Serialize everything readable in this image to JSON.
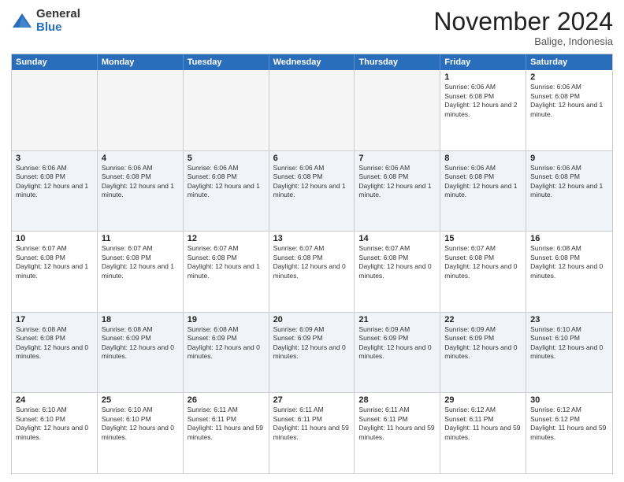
{
  "logo": {
    "general": "General",
    "blue": "Blue"
  },
  "header": {
    "month": "November 2024",
    "location": "Balige, Indonesia"
  },
  "weekdays": [
    "Sunday",
    "Monday",
    "Tuesday",
    "Wednesday",
    "Thursday",
    "Friday",
    "Saturday"
  ],
  "rows": [
    [
      {
        "day": "",
        "empty": true
      },
      {
        "day": "",
        "empty": true
      },
      {
        "day": "",
        "empty": true
      },
      {
        "day": "",
        "empty": true
      },
      {
        "day": "",
        "empty": true
      },
      {
        "day": "1",
        "sunrise": "Sunrise: 6:06 AM",
        "sunset": "Sunset: 6:08 PM",
        "daylight": "Daylight: 12 hours and 2 minutes."
      },
      {
        "day": "2",
        "sunrise": "Sunrise: 6:06 AM",
        "sunset": "Sunset: 6:08 PM",
        "daylight": "Daylight: 12 hours and 1 minute."
      }
    ],
    [
      {
        "day": "3",
        "sunrise": "Sunrise: 6:06 AM",
        "sunset": "Sunset: 6:08 PM",
        "daylight": "Daylight: 12 hours and 1 minute."
      },
      {
        "day": "4",
        "sunrise": "Sunrise: 6:06 AM",
        "sunset": "Sunset: 6:08 PM",
        "daylight": "Daylight: 12 hours and 1 minute."
      },
      {
        "day": "5",
        "sunrise": "Sunrise: 6:06 AM",
        "sunset": "Sunset: 6:08 PM",
        "daylight": "Daylight: 12 hours and 1 minute."
      },
      {
        "day": "6",
        "sunrise": "Sunrise: 6:06 AM",
        "sunset": "Sunset: 6:08 PM",
        "daylight": "Daylight: 12 hours and 1 minute."
      },
      {
        "day": "7",
        "sunrise": "Sunrise: 6:06 AM",
        "sunset": "Sunset: 6:08 PM",
        "daylight": "Daylight: 12 hours and 1 minute."
      },
      {
        "day": "8",
        "sunrise": "Sunrise: 6:06 AM",
        "sunset": "Sunset: 6:08 PM",
        "daylight": "Daylight: 12 hours and 1 minute."
      },
      {
        "day": "9",
        "sunrise": "Sunrise: 6:06 AM",
        "sunset": "Sunset: 6:08 PM",
        "daylight": "Daylight: 12 hours and 1 minute."
      }
    ],
    [
      {
        "day": "10",
        "sunrise": "Sunrise: 6:07 AM",
        "sunset": "Sunset: 6:08 PM",
        "daylight": "Daylight: 12 hours and 1 minute."
      },
      {
        "day": "11",
        "sunrise": "Sunrise: 6:07 AM",
        "sunset": "Sunset: 6:08 PM",
        "daylight": "Daylight: 12 hours and 1 minute."
      },
      {
        "day": "12",
        "sunrise": "Sunrise: 6:07 AM",
        "sunset": "Sunset: 6:08 PM",
        "daylight": "Daylight: 12 hours and 1 minute."
      },
      {
        "day": "13",
        "sunrise": "Sunrise: 6:07 AM",
        "sunset": "Sunset: 6:08 PM",
        "daylight": "Daylight: 12 hours and 0 minutes."
      },
      {
        "day": "14",
        "sunrise": "Sunrise: 6:07 AM",
        "sunset": "Sunset: 6:08 PM",
        "daylight": "Daylight: 12 hours and 0 minutes."
      },
      {
        "day": "15",
        "sunrise": "Sunrise: 6:07 AM",
        "sunset": "Sunset: 6:08 PM",
        "daylight": "Daylight: 12 hours and 0 minutes."
      },
      {
        "day": "16",
        "sunrise": "Sunrise: 6:08 AM",
        "sunset": "Sunset: 6:08 PM",
        "daylight": "Daylight: 12 hours and 0 minutes."
      }
    ],
    [
      {
        "day": "17",
        "sunrise": "Sunrise: 6:08 AM",
        "sunset": "Sunset: 6:08 PM",
        "daylight": "Daylight: 12 hours and 0 minutes."
      },
      {
        "day": "18",
        "sunrise": "Sunrise: 6:08 AM",
        "sunset": "Sunset: 6:09 PM",
        "daylight": "Daylight: 12 hours and 0 minutes."
      },
      {
        "day": "19",
        "sunrise": "Sunrise: 6:08 AM",
        "sunset": "Sunset: 6:09 PM",
        "daylight": "Daylight: 12 hours and 0 minutes."
      },
      {
        "day": "20",
        "sunrise": "Sunrise: 6:09 AM",
        "sunset": "Sunset: 6:09 PM",
        "daylight": "Daylight: 12 hours and 0 minutes."
      },
      {
        "day": "21",
        "sunrise": "Sunrise: 6:09 AM",
        "sunset": "Sunset: 6:09 PM",
        "daylight": "Daylight: 12 hours and 0 minutes."
      },
      {
        "day": "22",
        "sunrise": "Sunrise: 6:09 AM",
        "sunset": "Sunset: 6:09 PM",
        "daylight": "Daylight: 12 hours and 0 minutes."
      },
      {
        "day": "23",
        "sunrise": "Sunrise: 6:10 AM",
        "sunset": "Sunset: 6:10 PM",
        "daylight": "Daylight: 12 hours and 0 minutes."
      }
    ],
    [
      {
        "day": "24",
        "sunrise": "Sunrise: 6:10 AM",
        "sunset": "Sunset: 6:10 PM",
        "daylight": "Daylight: 12 hours and 0 minutes."
      },
      {
        "day": "25",
        "sunrise": "Sunrise: 6:10 AM",
        "sunset": "Sunset: 6:10 PM",
        "daylight": "Daylight: 12 hours and 0 minutes."
      },
      {
        "day": "26",
        "sunrise": "Sunrise: 6:11 AM",
        "sunset": "Sunset: 6:11 PM",
        "daylight": "Daylight: 11 hours and 59 minutes."
      },
      {
        "day": "27",
        "sunrise": "Sunrise: 6:11 AM",
        "sunset": "Sunset: 6:11 PM",
        "daylight": "Daylight: 11 hours and 59 minutes."
      },
      {
        "day": "28",
        "sunrise": "Sunrise: 6:11 AM",
        "sunset": "Sunset: 6:11 PM",
        "daylight": "Daylight: 11 hours and 59 minutes."
      },
      {
        "day": "29",
        "sunrise": "Sunrise: 6:12 AM",
        "sunset": "Sunset: 6:11 PM",
        "daylight": "Daylight: 11 hours and 59 minutes."
      },
      {
        "day": "30",
        "sunrise": "Sunrise: 6:12 AM",
        "sunset": "Sunset: 6:12 PM",
        "daylight": "Daylight: 11 hours and 59 minutes."
      }
    ]
  ]
}
